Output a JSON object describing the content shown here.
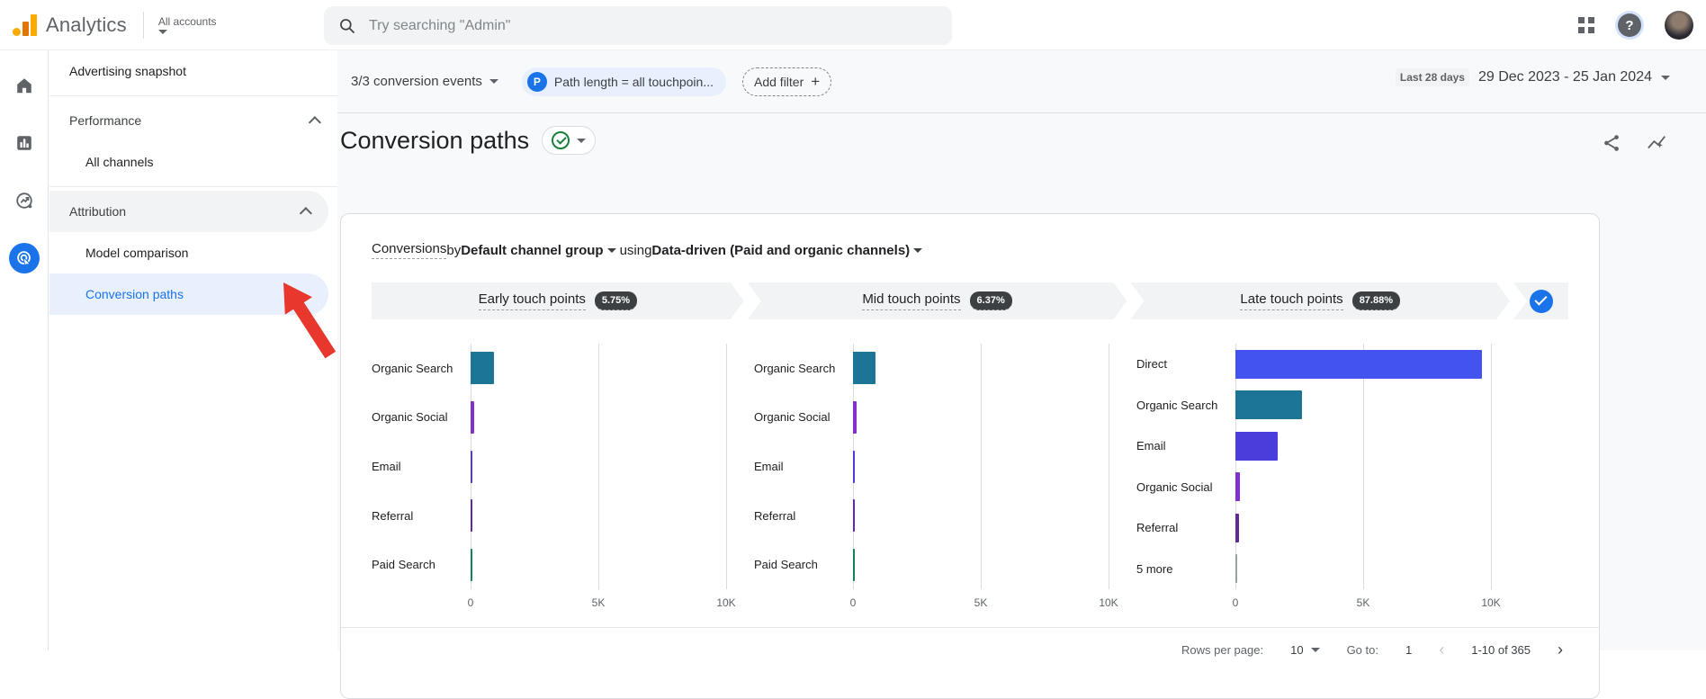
{
  "topbar": {
    "product": "Analytics",
    "account_label": "All accounts",
    "search_placeholder": "Try searching \"Admin\""
  },
  "sidebar": {
    "items": [
      {
        "label": "Advertising snapshot"
      },
      {
        "label": "Performance"
      },
      {
        "label": "All channels"
      },
      {
        "label": "Attribution"
      },
      {
        "label": "Model comparison"
      },
      {
        "label": "Conversion paths"
      }
    ]
  },
  "filters": {
    "conversion_events": "3/3 conversion events",
    "path_chip_icon": "P",
    "path_chip_label": "Path length = all touchpoin...",
    "add_filter_label": "Add filter",
    "add_filter_plus": "+"
  },
  "date_picker": {
    "preset": "Last 28 days",
    "range": "29 Dec 2023 - 25 Jan 2024"
  },
  "page": {
    "title": "Conversion paths"
  },
  "card": {
    "header": {
      "metric": "Conversions",
      "by": " by ",
      "dimension": "Default channel group",
      "using": "using ",
      "model": "Data-driven (Paid and organic channels)"
    },
    "funnel": [
      {
        "label": "Early touch points",
        "pct": "5.75%"
      },
      {
        "label": "Mid touch points",
        "pct": "6.37%"
      },
      {
        "label": "Late touch points",
        "pct": "87.88%"
      }
    ]
  },
  "chart_data": [
    {
      "type": "bar",
      "orientation": "horizontal",
      "title": "Early touch points",
      "share_of_conversions": "5.75%",
      "categories": [
        "Organic Search",
        "Organic Social",
        "Email",
        "Referral",
        "Paid Search"
      ],
      "values": [
        900,
        150,
        45,
        35,
        25
      ],
      "colors": [
        "#1d7596",
        "#8430ce",
        "#4b3ddb",
        "#5e2b97",
        "#12805c"
      ],
      "xlim": [
        0,
        10000
      ],
      "xticks": [
        0,
        5000,
        10000
      ],
      "xtick_labels": [
        "0",
        "5K",
        "10K"
      ],
      "grid": true
    },
    {
      "type": "bar",
      "orientation": "horizontal",
      "title": "Mid touch points",
      "share_of_conversions": "6.37%",
      "categories": [
        "Organic Search",
        "Organic Social",
        "Email",
        "Referral",
        "Paid Search"
      ],
      "values": [
        880,
        140,
        40,
        30,
        20
      ],
      "colors": [
        "#1d7596",
        "#8430ce",
        "#4b3ddb",
        "#5e2b97",
        "#12805c"
      ],
      "xlim": [
        0,
        10000
      ],
      "xticks": [
        0,
        5000,
        10000
      ],
      "xtick_labels": [
        "0",
        "5K",
        "10K"
      ],
      "grid": true
    },
    {
      "type": "bar",
      "orientation": "horizontal",
      "title": "Late touch points",
      "share_of_conversions": "87.88%",
      "categories": [
        "Direct",
        "Organic Search",
        "Email",
        "Organic Social",
        "Referral",
        "5 more"
      ],
      "values": [
        9650,
        2600,
        1650,
        160,
        140,
        60
      ],
      "colors": [
        "#4253f0",
        "#1d7596",
        "#4b3ddb",
        "#8430ce",
        "#5e2b97",
        "#9aa0a6"
      ],
      "xlim": [
        0,
        10000
      ],
      "xticks": [
        0,
        5000,
        10000
      ],
      "xtick_labels": [
        "0",
        "5K",
        "10K"
      ],
      "grid": true
    }
  ],
  "pagination": {
    "rows_per_page_label": "Rows per page:",
    "rows_per_page": "10",
    "go_to_label": "Go to:",
    "page": "1",
    "range": "1-10 of 365",
    "prev": "‹",
    "next": "›"
  }
}
